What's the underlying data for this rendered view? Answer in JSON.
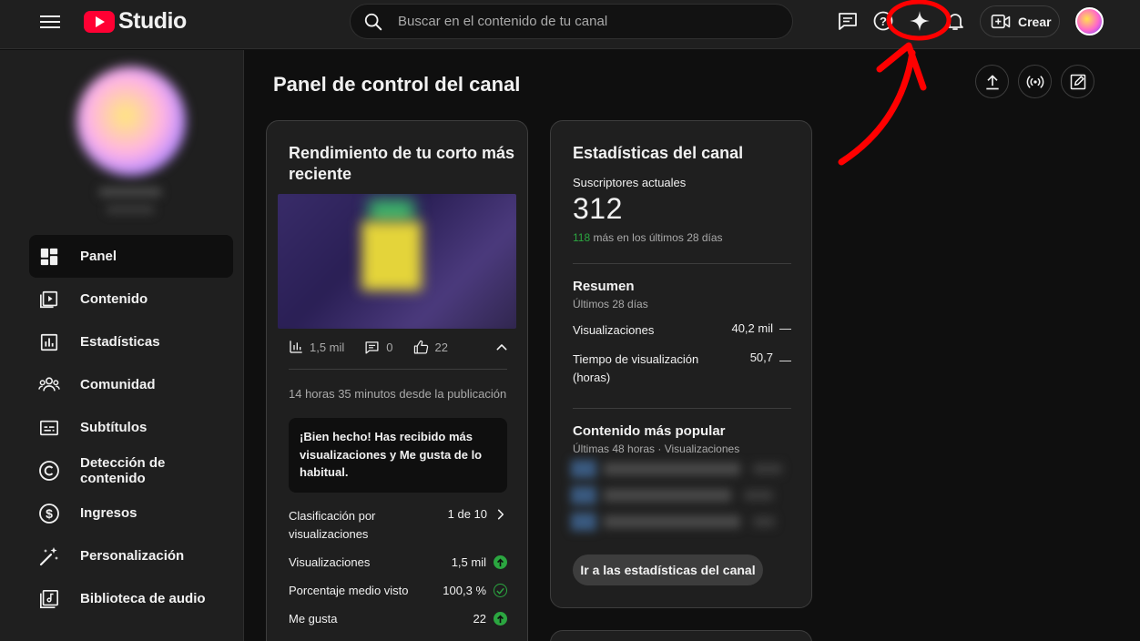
{
  "topbar": {
    "logo_text": "Studio",
    "search_placeholder": "Buscar en el contenido de tu canal",
    "create_label": "Crear"
  },
  "sidebar": {
    "items": [
      {
        "label": "Panel",
        "icon": "dashboard-icon",
        "active": true
      },
      {
        "label": "Contenido",
        "icon": "content-icon"
      },
      {
        "label": "Estadísticas",
        "icon": "analytics-icon"
      },
      {
        "label": "Comunidad",
        "icon": "community-icon"
      },
      {
        "label": "Subtítulos",
        "icon": "subtitles-icon"
      },
      {
        "label": "Detección de contenido",
        "icon": "copyright-icon"
      },
      {
        "label": "Ingresos",
        "icon": "dollar-icon"
      },
      {
        "label": "Personalización",
        "icon": "magic-wand-icon"
      },
      {
        "label": "Biblioteca de audio",
        "icon": "audio-library-icon"
      }
    ]
  },
  "page": {
    "title": "Panel de control del canal"
  },
  "short_card": {
    "title": "Rendimiento de tu corto más reciente",
    "views_short": "1,5 mil",
    "comments": "0",
    "likes": "22",
    "since_text": "14 horas 35 minutos desde la publicación",
    "praise": "¡Bien hecho! Has recibido más visualizaciones y Me gusta de lo habitual.",
    "rows": [
      {
        "label": "Clasificación por visualizaciones",
        "value": "1 de 10"
      },
      {
        "label": "Visualizaciones",
        "value": "1,5 mil"
      },
      {
        "label": "Porcentaje medio visto",
        "value": "100,3 %"
      },
      {
        "label": "Me gusta",
        "value": "22"
      }
    ]
  },
  "stats_card": {
    "title": "Estadísticas del canal",
    "subs_label": "Suscriptores actuales",
    "subs_value": "312",
    "subs_delta": "118",
    "subs_delta_text": "más en los últimos 28 días",
    "summary_title": "Resumen",
    "summary_period": "Últimos 28 días",
    "summary_rows": [
      {
        "label": "Visualizaciones",
        "value": "40,2 mil",
        "trend": "—"
      },
      {
        "label": "Tiempo de visualización (horas)",
        "value": "50,7",
        "trend": "—"
      }
    ],
    "popular_title": "Contenido más popular",
    "popular_subtitle": "Últimas 48 horas · Visualizaciones",
    "go_button": "Ir a las estadísticas del canal"
  },
  "colors": {
    "background": "#0f0f0f",
    "surface": "#1f1f1f",
    "border": "#3d3d3d",
    "brand_red": "#ff0033",
    "positive_green": "#2ba640",
    "annotation_red": "#ff0000"
  }
}
